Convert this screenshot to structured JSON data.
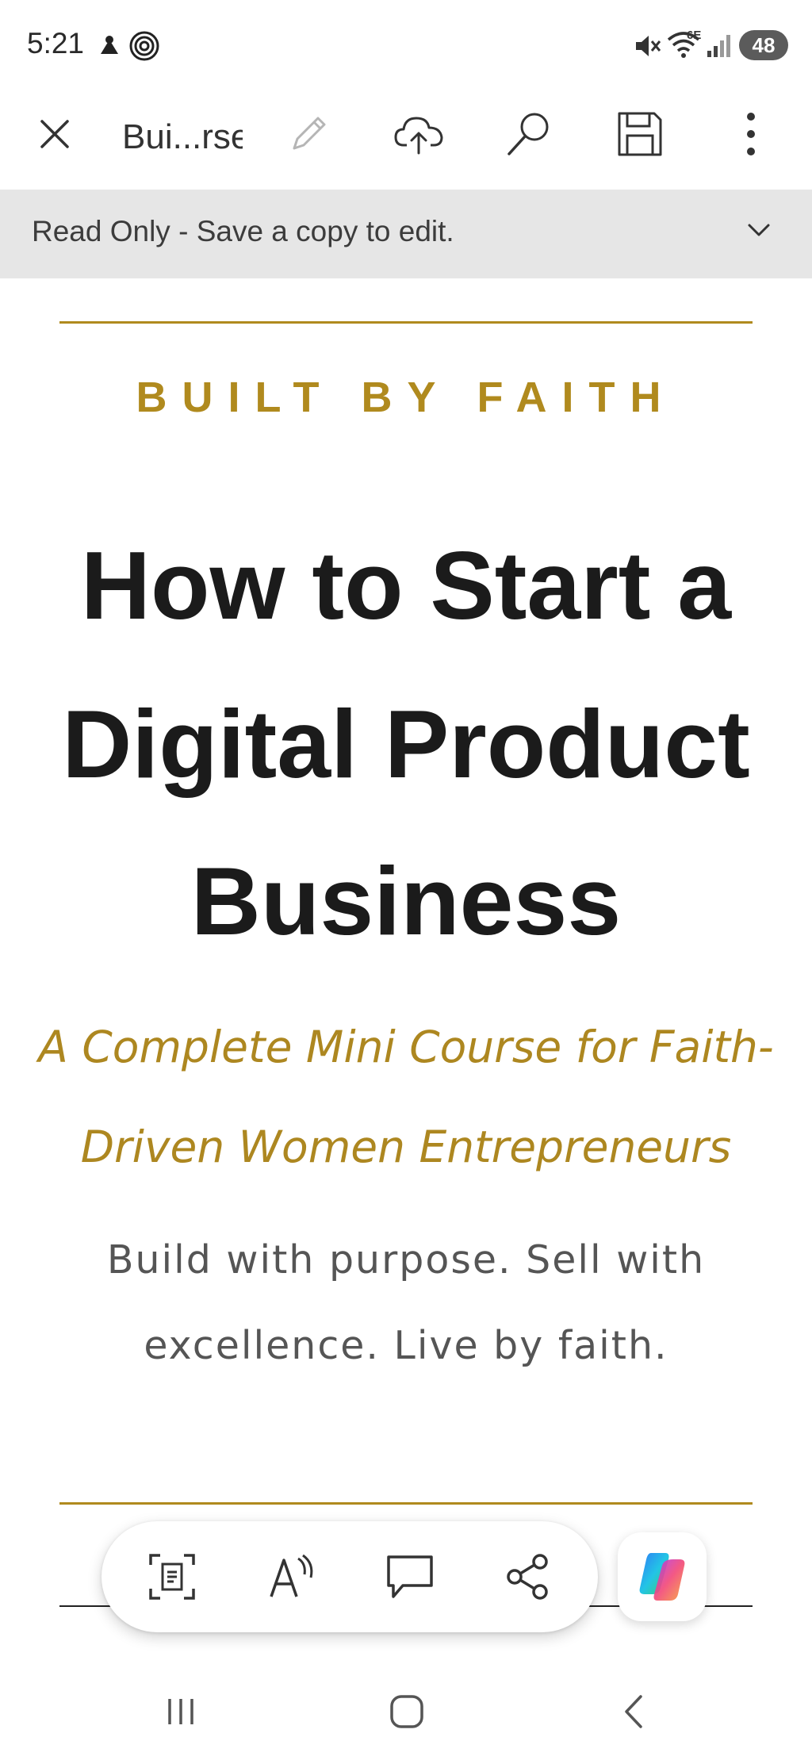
{
  "status_bar": {
    "time": "5:21",
    "battery": "48",
    "network": "6E",
    "icons": [
      "notification-icon",
      "fingerprint-icon",
      "mute-icon",
      "wifi-icon",
      "signal-icon",
      "battery-icon"
    ]
  },
  "toolbar": {
    "doc_title": "Bui...rse",
    "icons": [
      "close-icon",
      "pencil-icon",
      "cloud-upload-icon",
      "search-icon",
      "save-icon",
      "more-vertical-icon"
    ]
  },
  "banner": {
    "text": "Read Only - Save a copy to edit."
  },
  "document": {
    "kicker": "BUILT BY FAITH",
    "title_lines": [
      "How to Start a",
      "Digital Product",
      "Business"
    ],
    "subtitle_lines": [
      "A Complete Mini Course for Faith-",
      "Driven Women Entrepreneurs"
    ],
    "tagline_lines": [
      "Build with purpose. Sell with",
      "excellence. Live by faith."
    ]
  },
  "colors": {
    "accent_gold": "#b08a1e",
    "title_black": "#1b1b1b",
    "banner_gray": "#e6e6e6"
  },
  "floating_bar": {
    "icons": [
      "scan-document-icon",
      "read-aloud-icon",
      "comment-icon",
      "share-icon",
      "copilot-icon"
    ]
  },
  "system_nav": {
    "icons": [
      "recents-icon",
      "home-icon",
      "back-icon"
    ]
  }
}
